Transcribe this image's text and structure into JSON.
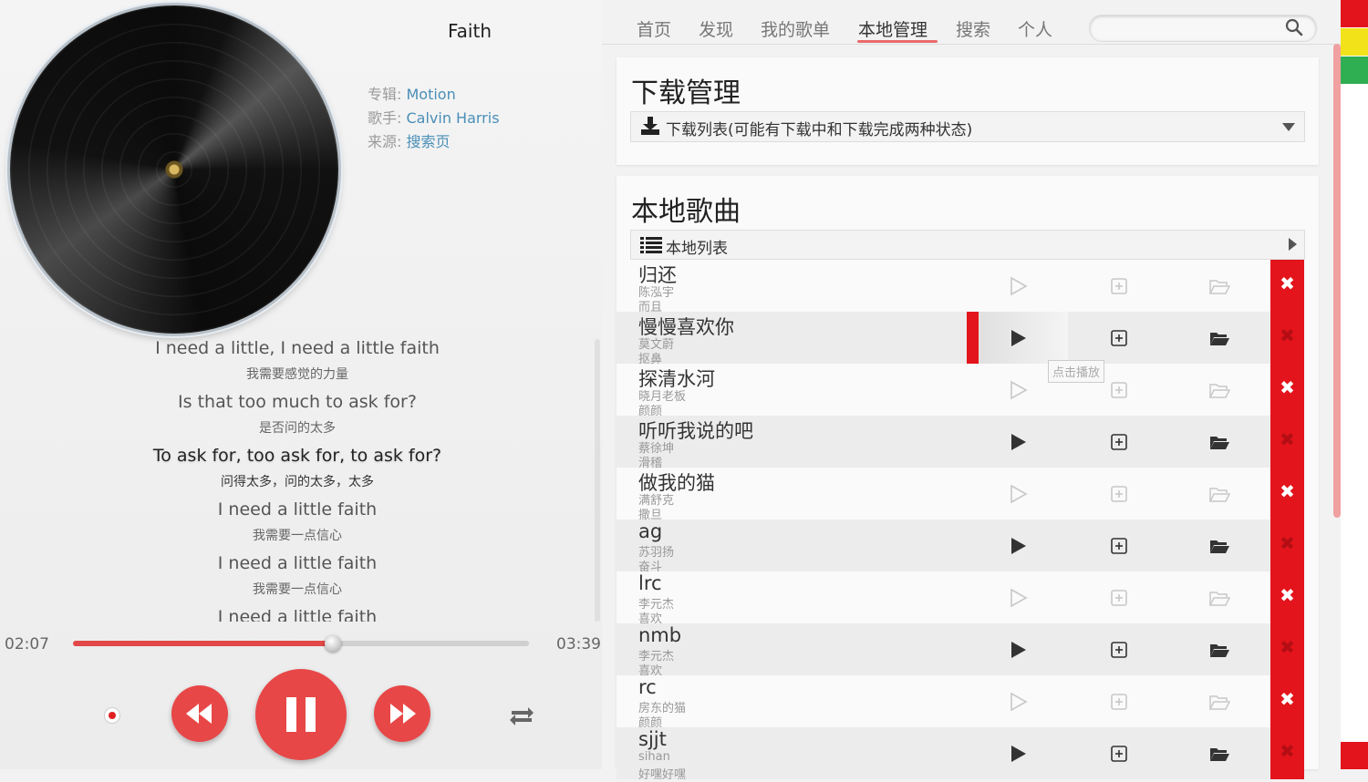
{
  "player": {
    "title": "Faith",
    "album_label": "专辑: ",
    "album": "Motion",
    "artist_label": "歌手: ",
    "artist": "Calvin Harris",
    "source_label": "来源: ",
    "source": "搜索页",
    "current_time": "02:07",
    "total_time": "03:39",
    "progress_fraction": 0.57
  },
  "lyrics": [
    {
      "en": "I need a little, I need a little faith",
      "cn": "我需要感觉的力量",
      "active": false
    },
    {
      "en": "Is that too much to ask for?",
      "cn": "是否问的太多",
      "active": false
    },
    {
      "en": "To ask for, too ask for, to ask for?",
      "cn": "问得太多，问的太多，太多",
      "active": true
    },
    {
      "en": "I need a little faith",
      "cn": "我需要一点信心",
      "active": false
    },
    {
      "en": "I need a little faith",
      "cn": "我需要一点信心",
      "active": false
    },
    {
      "en": "I need a little faith",
      "cn": "",
      "active": false
    }
  ],
  "nav": {
    "items": [
      "首页",
      "发现",
      "我的歌单",
      "本地管理",
      "搜索",
      "个人"
    ],
    "active_index": 3,
    "search_placeholder": ""
  },
  "download": {
    "heading": "下载管理",
    "list_label": "下载列表(可能有下载中和下载完成两种状态)"
  },
  "local": {
    "heading": "本地歌曲",
    "list_label": "本地列表",
    "tooltip": "点击播放",
    "songs": [
      {
        "name": "归还",
        "artist": "陈泓宇",
        "album": "而且"
      },
      {
        "name": "慢慢喜欢你",
        "artist": "莫文蔚",
        "album": "抠鼻"
      },
      {
        "name": "探清水河",
        "artist": "晓月老板",
        "album": "颜颜"
      },
      {
        "name": "听听我说的吧",
        "artist": "蔡徐坤",
        "album": "滑稽"
      },
      {
        "name": "做我的猫",
        "artist": "满舒克",
        "album": "撒旦"
      },
      {
        "name": "ag",
        "artist": "苏羽扬",
        "album": "奋斗"
      },
      {
        "name": "lrc",
        "artist": "李元杰",
        "album": "喜欢"
      },
      {
        "name": "nmb",
        "artist": "李元杰",
        "album": "喜欢"
      },
      {
        "name": "rc",
        "artist": "房东的猫",
        "album": "颜颜"
      },
      {
        "name": "sjjt",
        "artist": "sihan",
        "album": "好嘿好嘿"
      }
    ]
  },
  "colors": {
    "accent": "#e84747",
    "delete": "#e3141b",
    "link": "#4a8fb8"
  }
}
